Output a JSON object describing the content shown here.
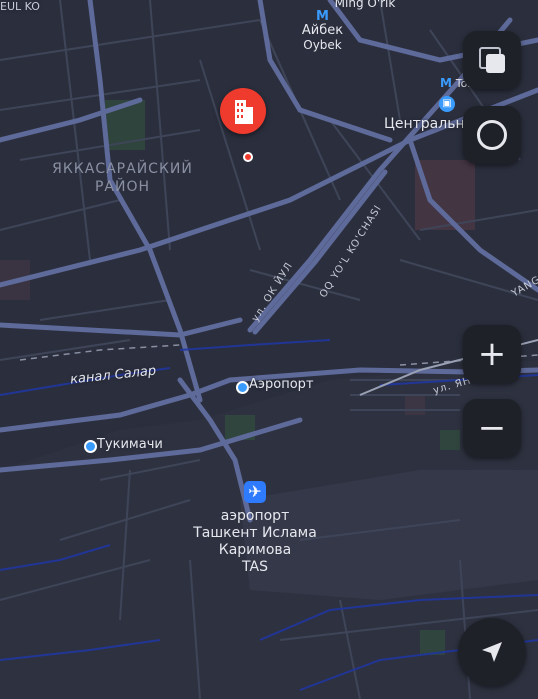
{
  "map": {
    "district_line1": "ЯККАСАРАЙСКИЙ",
    "district_line2": "РАЙОН",
    "metro_ming": "Ming O'rik",
    "metro_aybek_ru": "Айбек",
    "metro_aybek_en": "Oybek",
    "metro_tashkent": "Toshkent",
    "central_label": "Центральны",
    "street_oqyol_ru": "ул. ОК ЙУЛ",
    "street_oqyol_en": "OQ YO'L KO'CHASI",
    "street_yang": "ул. ЯН",
    "street_yang_en": "YANG",
    "street_top_left": "EUL KO",
    "canal": "канал Салар",
    "place_airport": "Аэропорт",
    "place_tukimachi": "Тукимачи",
    "airport_line1": "аэропорт",
    "airport_line2": "Ташкент Ислама",
    "airport_line3": "Каримова",
    "airport_line4": "TAS"
  },
  "controls": {
    "zoom_in": "+",
    "zoom_out": "−"
  }
}
